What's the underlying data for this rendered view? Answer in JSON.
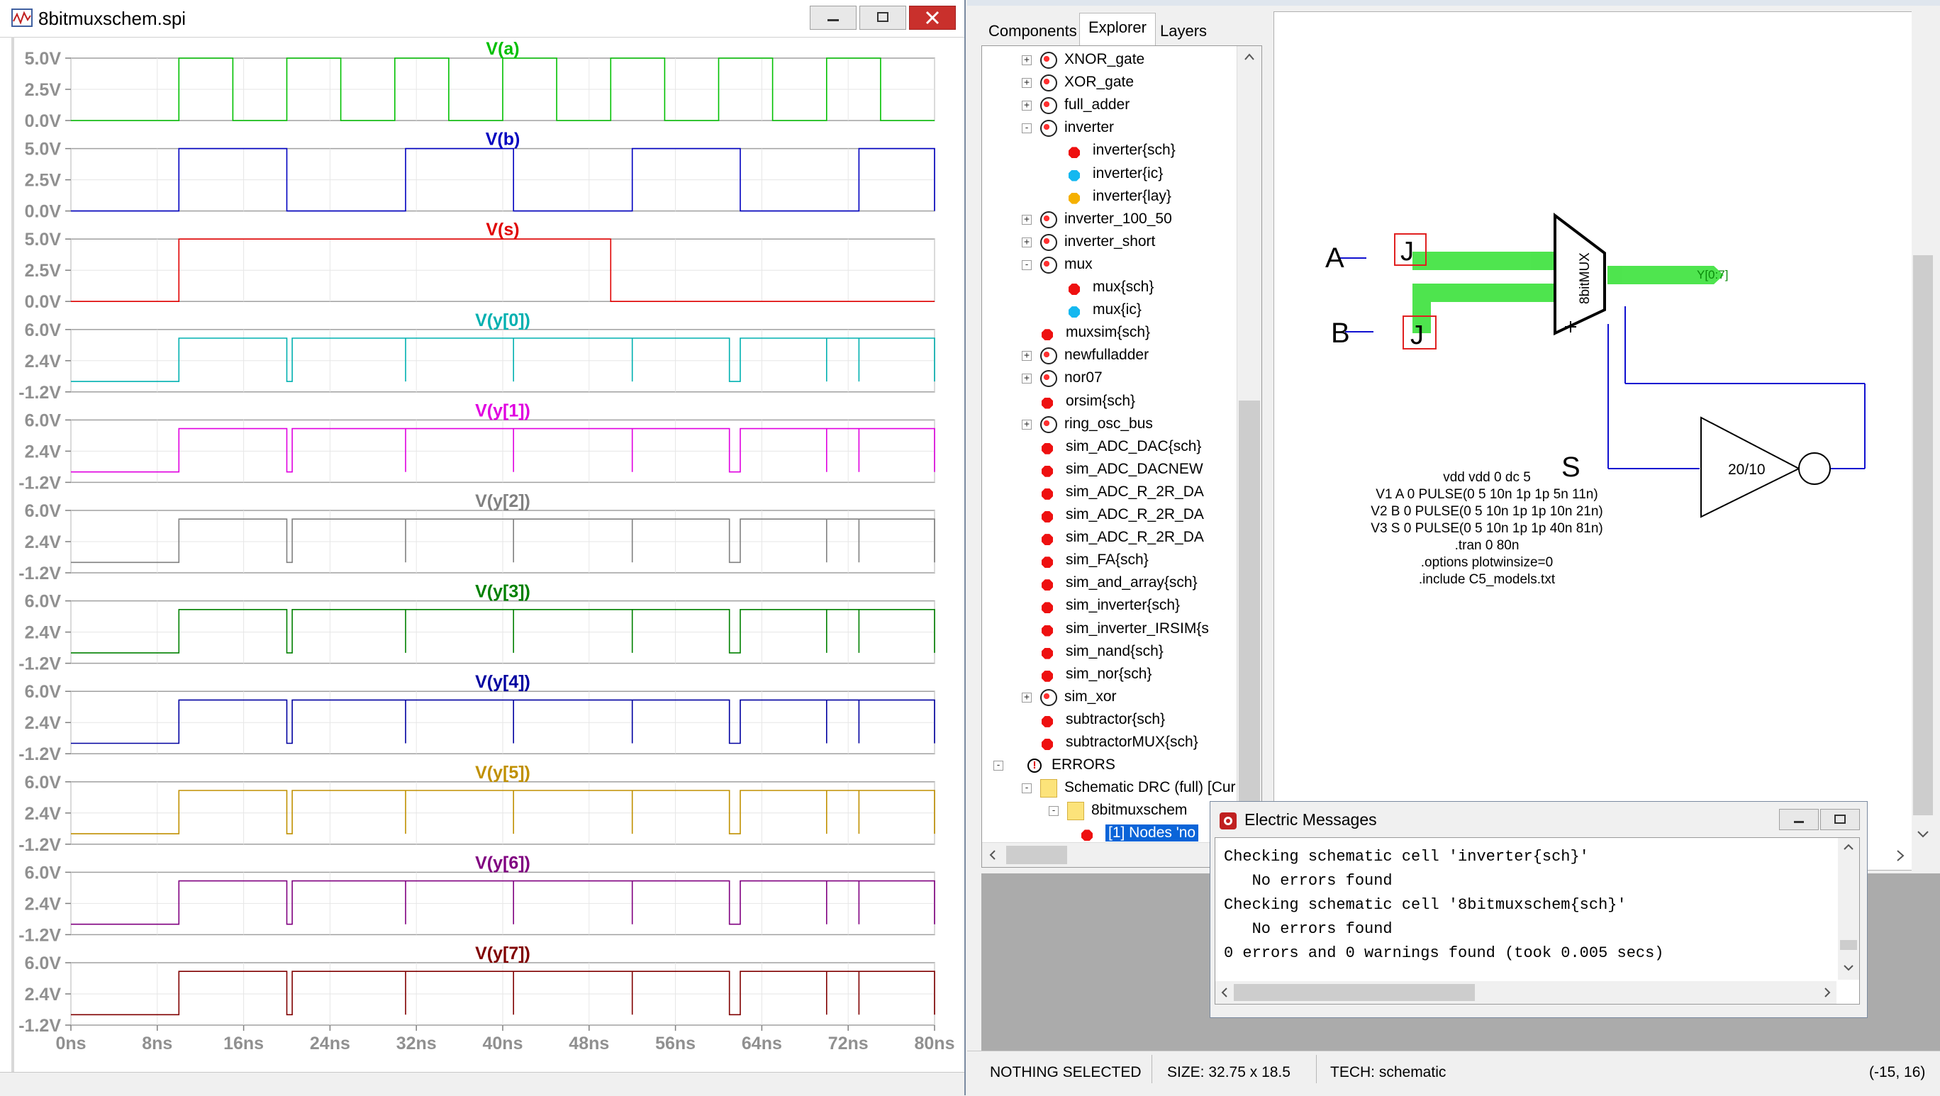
{
  "left_window": {
    "title": "8bitmuxschem.spi",
    "icon": "waveform-icon"
  },
  "chart_data": {
    "type": "line",
    "xlabel": "",
    "x_ticks": [
      "0ns",
      "8ns",
      "16ns",
      "24ns",
      "32ns",
      "40ns",
      "48ns",
      "56ns",
      "64ns",
      "72ns",
      "80ns"
    ],
    "xlim": [
      0,
      80
    ],
    "grid": true,
    "panels": [
      {
        "name": "V(a)",
        "color": "#00c000",
        "ylim": [
          0,
          5
        ],
        "y_ticks": [
          "5.0V",
          "2.5V",
          "0.0V"
        ],
        "period": 10,
        "delay": 10,
        "width": 5,
        "high": 5,
        "low": 0
      },
      {
        "name": "V(b)",
        "color": "#0000c0",
        "ylim": [
          0,
          5
        ],
        "y_ticks": [
          "5.0V",
          "2.5V",
          "0.0V"
        ],
        "period": 21,
        "delay": 10,
        "width": 10,
        "high": 5,
        "low": 0
      },
      {
        "name": "V(s)",
        "color": "#e00000",
        "ylim": [
          0,
          5
        ],
        "y_ticks": [
          "5.0V",
          "2.5V",
          "0.0V"
        ],
        "period": 81,
        "delay": 10,
        "width": 40,
        "high": 5,
        "low": 0
      },
      {
        "name": "V(y[0])",
        "color": "#00b0b0",
        "ylim": [
          -1.2,
          6
        ],
        "y_ticks": [
          "6.0V",
          "2.4V",
          "-1.2V"
        ],
        "high": 5,
        "low": 0
      },
      {
        "name": "V(y[1])",
        "color": "#e000e0",
        "ylim": [
          -1.2,
          6
        ],
        "y_ticks": [
          "6.0V",
          "2.4V",
          "-1.2V"
        ],
        "high": 5,
        "low": 0
      },
      {
        "name": "V(y[2])",
        "color": "#808080",
        "ylim": [
          -1.2,
          6
        ],
        "y_ticks": [
          "6.0V",
          "2.4V",
          "-1.2V"
        ],
        "high": 5,
        "low": 0
      },
      {
        "name": "V(y[3])",
        "color": "#008000",
        "ylim": [
          -1.2,
          6
        ],
        "y_ticks": [
          "6.0V",
          "2.4V",
          "-1.2V"
        ],
        "high": 5,
        "low": 0
      },
      {
        "name": "V(y[4])",
        "color": "#0000a0",
        "ylim": [
          -1.2,
          6
        ],
        "y_ticks": [
          "6.0V",
          "2.4V",
          "-1.2V"
        ],
        "high": 5,
        "low": 0
      },
      {
        "name": "V(y[5])",
        "color": "#c09000",
        "ylim": [
          -1.2,
          6
        ],
        "y_ticks": [
          "6.0V",
          "2.4V",
          "-1.2V"
        ],
        "high": 5,
        "low": 0
      },
      {
        "name": "V(y[6])",
        "color": "#800080",
        "ylim": [
          -1.2,
          6
        ],
        "y_ticks": [
          "6.0V",
          "2.4V",
          "-1.2V"
        ],
        "high": 5,
        "low": 0
      },
      {
        "name": "V(y[7])",
        "color": "#800000",
        "ylim": [
          -1.2,
          6
        ],
        "y_ticks": [
          "6.0V",
          "2.4V",
          "-1.2V"
        ],
        "high": 5,
        "low": 0
      }
    ],
    "y_out_intervals": [
      [
        10,
        20
      ],
      [
        20.5,
        31
      ],
      [
        31,
        41
      ],
      [
        41,
        52
      ],
      [
        52,
        61
      ],
      [
        62,
        70
      ],
      [
        70,
        73
      ],
      [
        73,
        80
      ]
    ]
  },
  "explorer": {
    "tabs": [
      "Components",
      "Explorer",
      "Layers"
    ],
    "selected_tab": "Explorer",
    "items": [
      {
        "label": "XNOR_gate",
        "icon": "group",
        "expander": "+",
        "level": 1
      },
      {
        "label": "XOR_gate",
        "icon": "group",
        "expander": "+",
        "level": 1
      },
      {
        "label": "full_adder",
        "icon": "group",
        "expander": "+",
        "level": 1
      },
      {
        "label": "inverter",
        "icon": "group",
        "expander": "−",
        "level": 1
      },
      {
        "label": "inverter{sch}",
        "icon": "red",
        "expander": "",
        "level": 2
      },
      {
        "label": "inverter{ic}",
        "icon": "cyan",
        "expander": "",
        "level": 2
      },
      {
        "label": "inverter{lay}",
        "icon": "orange",
        "expander": "",
        "level": 2
      },
      {
        "label": "inverter_100_50",
        "icon": "group",
        "expander": "+",
        "level": 1
      },
      {
        "label": "inverter_short",
        "icon": "group",
        "expander": "+",
        "level": 1
      },
      {
        "label": "mux",
        "icon": "group",
        "expander": "−",
        "level": 1
      },
      {
        "label": "mux{sch}",
        "icon": "red",
        "expander": "",
        "level": 2
      },
      {
        "label": "mux{ic}",
        "icon": "cyan",
        "expander": "",
        "level": 2
      },
      {
        "label": "muxsim{sch}",
        "icon": "red",
        "expander": "",
        "level": 1
      },
      {
        "label": "newfulladder",
        "icon": "group",
        "expander": "+",
        "level": 1
      },
      {
        "label": "nor07",
        "icon": "group",
        "expander": "+",
        "level": 1
      },
      {
        "label": "orsim{sch}",
        "icon": "red",
        "expander": "",
        "level": 1
      },
      {
        "label": "ring_osc_bus",
        "icon": "group",
        "expander": "+",
        "level": 1
      },
      {
        "label": "sim_ADC_DAC{sch}",
        "icon": "red",
        "expander": "",
        "level": 1
      },
      {
        "label": "sim_ADC_DACNEW",
        "icon": "red",
        "expander": "",
        "level": 1
      },
      {
        "label": "sim_ADC_R_2R_DA",
        "icon": "red",
        "expander": "",
        "level": 1
      },
      {
        "label": "sim_ADC_R_2R_DA",
        "icon": "red",
        "expander": "",
        "level": 1
      },
      {
        "label": "sim_ADC_R_2R_DA",
        "icon": "red",
        "expander": "",
        "level": 1
      },
      {
        "label": "sim_FA{sch}",
        "icon": "red",
        "expander": "",
        "level": 1
      },
      {
        "label": "sim_and_array{sch}",
        "icon": "red",
        "expander": "",
        "level": 1
      },
      {
        "label": "sim_inverter{sch}",
        "icon": "red",
        "expander": "",
        "level": 1
      },
      {
        "label": "sim_inverter_IRSIM{s",
        "icon": "red",
        "expander": "",
        "level": 1
      },
      {
        "label": "sim_nand{sch}",
        "icon": "red",
        "expander": "",
        "level": 1
      },
      {
        "label": "sim_nor{sch}",
        "icon": "red",
        "expander": "",
        "level": 1
      },
      {
        "label": "sim_xor",
        "icon": "group",
        "expander": "+",
        "level": 1
      },
      {
        "label": "subtractor{sch}",
        "icon": "red",
        "expander": "",
        "level": 1
      },
      {
        "label": "subtractorMUX{sch}",
        "icon": "red",
        "expander": "",
        "level": 1
      },
      {
        "label": "ERRORS",
        "icon": "error",
        "expander": "−",
        "level": 0
      },
      {
        "label": "Schematic DRC (full) [Cur",
        "icon": "folder",
        "expander": "−",
        "level": 1
      },
      {
        "label": "8bitmuxschem",
        "icon": "folder",
        "expander": "−",
        "level": 2
      },
      {
        "label": "[1] Nodes 'no",
        "icon": "red",
        "expander": "",
        "level": 3,
        "selected": true
      }
    ]
  },
  "schematic": {
    "label_a": "A",
    "label_b": "B",
    "label_s": "S",
    "mux_label": "8bitMUX",
    "bus_label": "Y[0:7]",
    "buffer_label": "20/10",
    "export_glyph": "J",
    "spice_lines": [
      "vdd vdd 0 dc 5",
      "V1 A 0 PULSE(0 5 10n 1p 1p 5n 11n)",
      "V2 B 0 PULSE(0 5 10n 1p 1p 10n 21n)",
      "V3 S 0 PULSE(0 5 10n 1p 1p 40n 81n)",
      ".tran 0 80n",
      ".options plotwinsize=0",
      ".include C5_models.txt"
    ],
    "colors": {
      "wire": "#1010d0",
      "bus": "#30e030",
      "export_box": "#e02020"
    }
  },
  "messages": {
    "title": "Electric Messages",
    "lines": [
      "Checking schematic cell 'inverter{sch}'",
      "   No errors found",
      "Checking schematic cell '8bitmuxschem{sch}'",
      "   No errors found",
      "0 errors and 0 warnings found (took 0.005 secs)"
    ]
  },
  "status": {
    "selection": "NOTHING SELECTED",
    "size": "SIZE: 32.75 x 18.5",
    "tech": "TECH: schematic",
    "coords": "(-15, 16)"
  }
}
